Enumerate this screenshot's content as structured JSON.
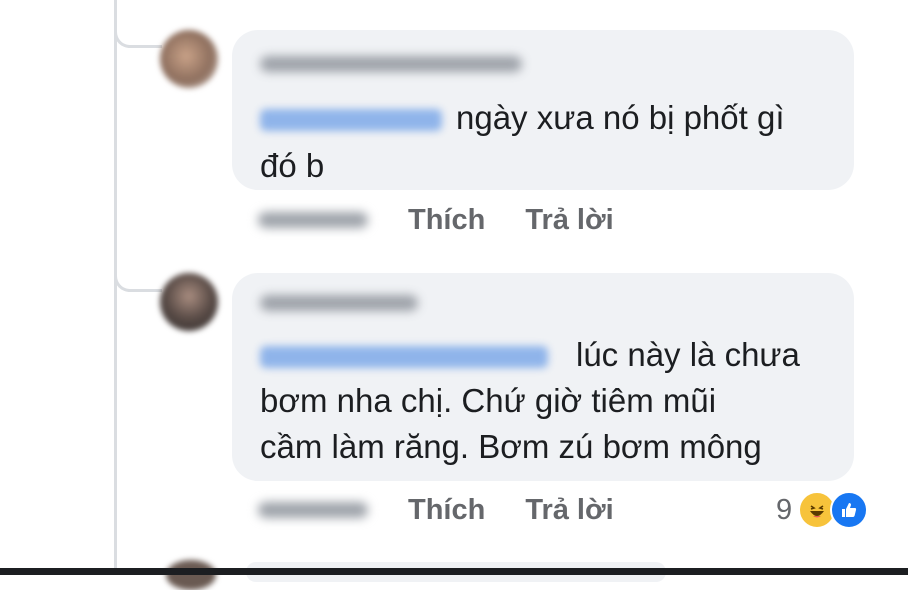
{
  "comments": [
    {
      "text_lines": [
        "ngày xưa nó bị phốt gì",
        "đó b"
      ],
      "actions": {
        "like": "Thích",
        "reply": "Trả lời"
      }
    },
    {
      "text_lines": [
        "lúc này là chưa",
        "bơm nha chị. Chứ giờ tiêm mũi",
        "cầm làm răng. Bơm zú bơm mông"
      ],
      "actions": {
        "like": "Thích",
        "reply": "Trả lời"
      },
      "reactions": {
        "count": "9",
        "types": [
          "haha-icon",
          "like-icon"
        ]
      }
    }
  ],
  "colors": {
    "bubble_bg": "#f0f2f5",
    "meta_text": "#65676b",
    "like_blue": "#1877f2",
    "haha_yellow": "#f7c33b"
  }
}
